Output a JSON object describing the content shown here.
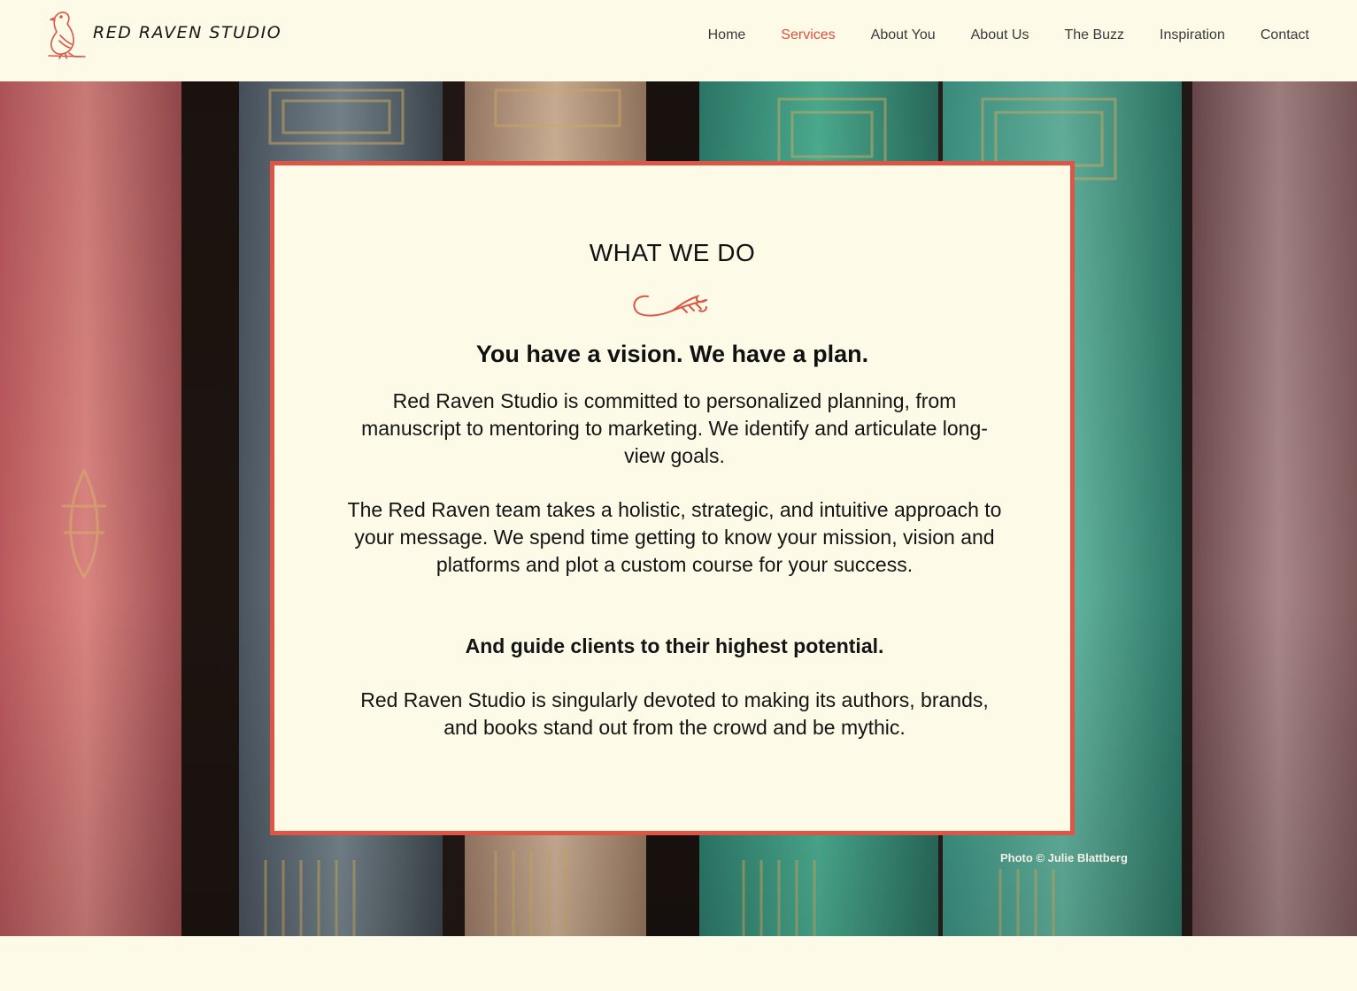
{
  "site": {
    "logo_text": "RED RAVEN STUDIO",
    "brand_color": "#dd5545",
    "background_color": "#fdfae8"
  },
  "nav": {
    "items": [
      {
        "label": "Home",
        "active": false
      },
      {
        "label": "Services",
        "active": true
      },
      {
        "label": "About You",
        "active": false
      },
      {
        "label": "About Us",
        "active": false
      },
      {
        "label": "The Buzz",
        "active": false
      },
      {
        "label": "Inspiration",
        "active": false
      },
      {
        "label": "Contact",
        "active": false
      }
    ]
  },
  "hero": {
    "heading": "WHAT WE DO",
    "ornament_icon": "raven-wing-flourish-icon",
    "tagline": "You have a vision. We have a plan.",
    "paragraphs": [
      "Red Raven Studio is committed to personalized planning, from manuscript to mentoring to marketing. We identify and articulate long-view goals.",
      "The Red Raven team takes a holistic, strategic, and intuitive approach to your message. We spend time getting to know your mission, vision and platforms and plot a custom course for your success.",
      "And guide clients to their highest potential.",
      "Red Raven Studio is singularly devoted to making its authors, brands, and books stand out from the crowd and be mythic."
    ],
    "photo_credit": "Photo © Julie Blattberg"
  }
}
